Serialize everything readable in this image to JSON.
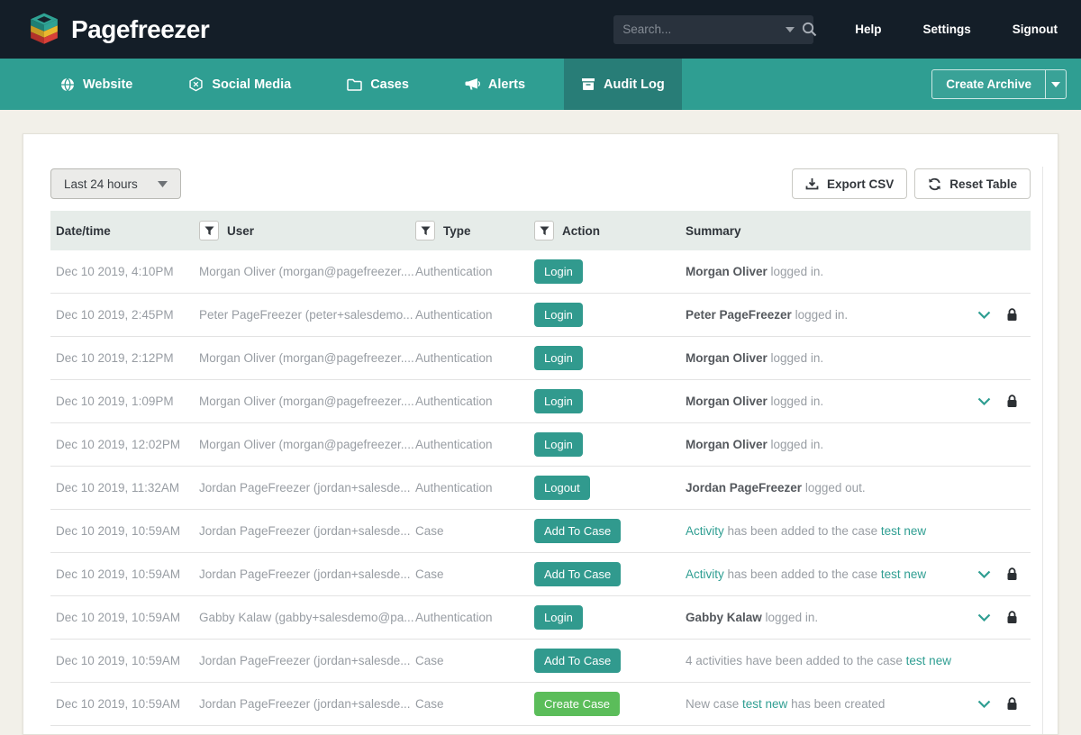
{
  "topbar": {
    "brand": "Pagefreezer",
    "search_placeholder": "Search...",
    "links": {
      "help": "Help",
      "settings": "Settings",
      "signout": "Signout"
    }
  },
  "nav": {
    "items": [
      {
        "label": "Website",
        "icon": "globe-icon",
        "active": false
      },
      {
        "label": "Social Media",
        "icon": "hexagon-icon",
        "active": false
      },
      {
        "label": "Cases",
        "icon": "folder-icon",
        "active": false
      },
      {
        "label": "Alerts",
        "icon": "megaphone-icon",
        "active": false
      },
      {
        "label": "Audit Log",
        "icon": "archive-icon",
        "active": true
      }
    ],
    "create_archive_label": "Create Archive"
  },
  "toolbar": {
    "range_filter": "Last 24 hours",
    "export_label": "Export CSV",
    "reset_label": "Reset Table"
  },
  "table": {
    "columns": {
      "datetime": "Date/time",
      "user": "User",
      "type": "Type",
      "action": "Action",
      "summary": "Summary"
    },
    "rows": [
      {
        "datetime": "Dec 10 2019, 4:10PM",
        "user": "Morgan Oliver (morgan@pagefreezer....",
        "type": "Authentication",
        "action": "Login",
        "action_color": "teal",
        "expandable": false,
        "summary": [
          {
            "text": "Morgan Oliver",
            "style": "bold"
          },
          {
            "text": " logged in.",
            "style": "plain"
          }
        ]
      },
      {
        "datetime": "Dec 10 2019, 2:45PM",
        "user": "Peter PageFreezer (peter+salesdemo...",
        "type": "Authentication",
        "action": "Login",
        "action_color": "teal",
        "expandable": true,
        "summary": [
          {
            "text": "Peter PageFreezer",
            "style": "bold"
          },
          {
            "text": " logged in.",
            "style": "plain"
          }
        ]
      },
      {
        "datetime": "Dec 10 2019, 2:12PM",
        "user": "Morgan Oliver (morgan@pagefreezer....",
        "type": "Authentication",
        "action": "Login",
        "action_color": "teal",
        "expandable": false,
        "summary": [
          {
            "text": "Morgan Oliver",
            "style": "bold"
          },
          {
            "text": " logged in.",
            "style": "plain"
          }
        ]
      },
      {
        "datetime": "Dec 10 2019, 1:09PM",
        "user": "Morgan Oliver (morgan@pagefreezer....",
        "type": "Authentication",
        "action": "Login",
        "action_color": "teal",
        "expandable": true,
        "summary": [
          {
            "text": "Morgan Oliver",
            "style": "bold"
          },
          {
            "text": " logged in.",
            "style": "plain"
          }
        ]
      },
      {
        "datetime": "Dec 10 2019, 12:02PM",
        "user": "Morgan Oliver (morgan@pagefreezer....",
        "type": "Authentication",
        "action": "Login",
        "action_color": "teal",
        "expandable": false,
        "summary": [
          {
            "text": "Morgan Oliver",
            "style": "bold"
          },
          {
            "text": " logged in.",
            "style": "plain"
          }
        ]
      },
      {
        "datetime": "Dec 10 2019, 11:32AM",
        "user": "Jordan PageFreezer (jordan+salesde...",
        "type": "Authentication",
        "action": "Logout",
        "action_color": "teal",
        "expandable": false,
        "summary": [
          {
            "text": "Jordan PageFreezer",
            "style": "bold"
          },
          {
            "text": " logged out.",
            "style": "plain"
          }
        ]
      },
      {
        "datetime": "Dec 10 2019, 10:59AM",
        "user": "Jordan PageFreezer (jordan+salesde...",
        "type": "Case",
        "action": "Add To Case",
        "action_color": "teal",
        "expandable": false,
        "summary": [
          {
            "text": "Activity",
            "style": "link"
          },
          {
            "text": " has been added to the case ",
            "style": "plain"
          },
          {
            "text": "test new",
            "style": "link"
          }
        ]
      },
      {
        "datetime": "Dec 10 2019, 10:59AM",
        "user": "Jordan PageFreezer (jordan+salesde...",
        "type": "Case",
        "action": "Add To Case",
        "action_color": "teal",
        "expandable": true,
        "summary": [
          {
            "text": "Activity",
            "style": "link"
          },
          {
            "text": " has been added to the case ",
            "style": "plain"
          },
          {
            "text": "test new",
            "style": "link"
          }
        ]
      },
      {
        "datetime": "Dec 10 2019, 10:59AM",
        "user": "Gabby Kalaw (gabby+salesdemo@pa...",
        "type": "Authentication",
        "action": "Login",
        "action_color": "teal",
        "expandable": true,
        "summary": [
          {
            "text": "Gabby Kalaw",
            "style": "bold"
          },
          {
            "text": " logged in.",
            "style": "plain"
          }
        ]
      },
      {
        "datetime": "Dec 10 2019, 10:59AM",
        "user": "Jordan PageFreezer (jordan+salesde...",
        "type": "Case",
        "action": "Add To Case",
        "action_color": "teal",
        "expandable": false,
        "summary": [
          {
            "text": "4 activities have been added to the case ",
            "style": "plain"
          },
          {
            "text": "test new",
            "style": "link"
          }
        ]
      },
      {
        "datetime": "Dec 10 2019, 10:59AM",
        "user": "Jordan PageFreezer (jordan+salesde...",
        "type": "Case",
        "action": "Create Case",
        "action_color": "green",
        "expandable": true,
        "summary": [
          {
            "text": "New case ",
            "style": "plain"
          },
          {
            "text": "test new",
            "style": "link"
          },
          {
            "text": " has been created",
            "style": "plain"
          }
        ]
      }
    ]
  },
  "colors": {
    "topbar_bg": "#141e28",
    "nav_bg": "#2f9e92",
    "nav_active_bg": "#287d77",
    "badge_teal": "#319a8e",
    "badge_green": "#5bbd5a",
    "link_teal": "#2f9e92",
    "page_bg": "#f2f0e9",
    "table_header_bg": "#e6ece9"
  }
}
